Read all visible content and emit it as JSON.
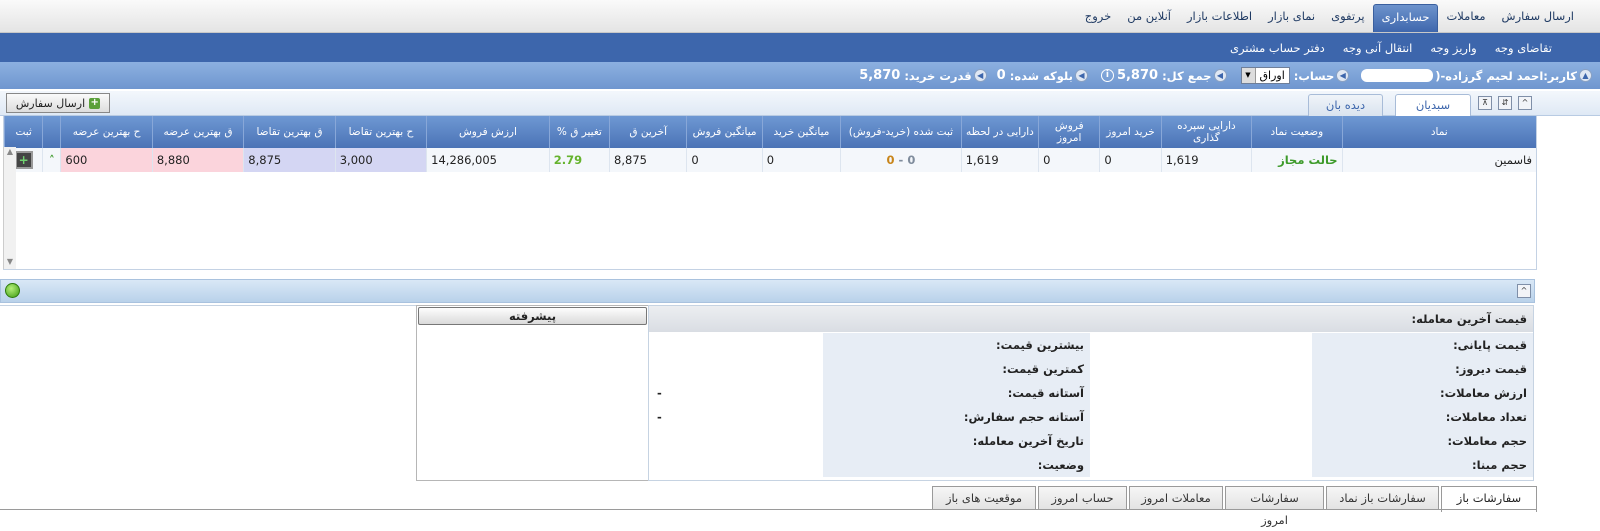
{
  "main_menu": [
    "ارسال سفارش",
    "معاملات",
    "حسابداری",
    "پرتفوی",
    "نمای بازار",
    "اطلاعات بازار",
    "آنلاین من",
    "خروج"
  ],
  "main_menu_active": "حسابداری",
  "sub_menu": [
    "تقاضای وجه",
    "واریز وجه",
    "انتقال آنی وجه",
    "دفتر حساب مشتری"
  ],
  "user_bar": {
    "user_label": "کاربر:",
    "user_name": "احمد لحیم گرزاده-(",
    "account_label": "حساب:",
    "account_value": "اوراق",
    "total_label": "جمع کل:",
    "total_value": "5,870",
    "blocked_label": "بلوکه شده:",
    "blocked_value": "0",
    "buying_power_label": "قدرت خرید:",
    "buying_power_value": "5,870",
    "info_glyph": "i"
  },
  "top_tabs": {
    "active": "سبدیان",
    "other": "دیده بان"
  },
  "send_order_button": "ارسال سفارش",
  "grid": {
    "columns": [
      "نماد",
      "وضعیت نماد",
      "دارایی سپرده گذاری",
      "خرید امروز",
      "فروش امروز",
      "دارایی در لحظه",
      "ثبت شده (خرید-فروش)",
      "میانگین خرید",
      "میانگین فروش",
      "آخرین ق",
      "تغییر ق %",
      "ارزش فروش",
      "ح بهترین تقاضا",
      "ق بهترین تقاضا",
      "ق بهترین عرضه",
      "ح بهترین عرضه",
      "",
      "ثبت"
    ],
    "row": {
      "symbol": "فاسمین",
      "status": "حالت مجاز",
      "deposit_assets": "1,619",
      "buy_today": "0",
      "sell_today": "0",
      "assets_now": "1,619",
      "registered_buy": "0",
      "registered_sep": "-",
      "registered_sell": "0",
      "avg_buy": "0",
      "avg_sell": "0",
      "last_price": "8,875",
      "change_pct": "2.79",
      "sell_value": "14,286,005",
      "best_bid_vol": "3,000",
      "best_bid_price": "8,875",
      "best_ask_price": "8,880",
      "best_ask_vol": "600"
    }
  },
  "details": {
    "header": "قیمت آخرین معامله:",
    "rows": [
      {
        "label_a": "قیمت پایانی:",
        "value_a": "",
        "label_b": "بیشترین قیمت:",
        "value_b": ""
      },
      {
        "label_a": "قیمت دیروز:",
        "value_a": "",
        "label_b": "کمترین قیمت:",
        "value_b": ""
      },
      {
        "label_a": "ارزش معاملات:",
        "value_a": "",
        "label_b": "آستانه قیمت:",
        "value_b": "-"
      },
      {
        "label_a": "تعداد معاملات:",
        "value_a": "",
        "label_b": "آستانه حجم سفارش:",
        "value_b": "-"
      },
      {
        "label_a": "حجم معاملات:",
        "value_a": "",
        "label_b": "تاریخ آخرین معامله:",
        "value_b": ""
      },
      {
        "label_a": "حجم مبنا:",
        "value_a": "",
        "label_b": "وضعیت:",
        "value_b": ""
      }
    ]
  },
  "advanced_button": "پیشرفته",
  "bottom_tabs": [
    "سفارشات باز",
    "سفارشات باز نماد",
    "سفارشات امروز",
    "معاملات امروز",
    "حساب امروز",
    "موقعیت های باز"
  ],
  "bottom_tabs_active": "سفارشات باز",
  "colors": {
    "menu_blue": "#3d66ac",
    "grid_header": "#5b83c2",
    "ask_pink": "#fbd4dc",
    "bid_lavender": "#d4d6f3",
    "status_green": "#3d9a2a"
  }
}
